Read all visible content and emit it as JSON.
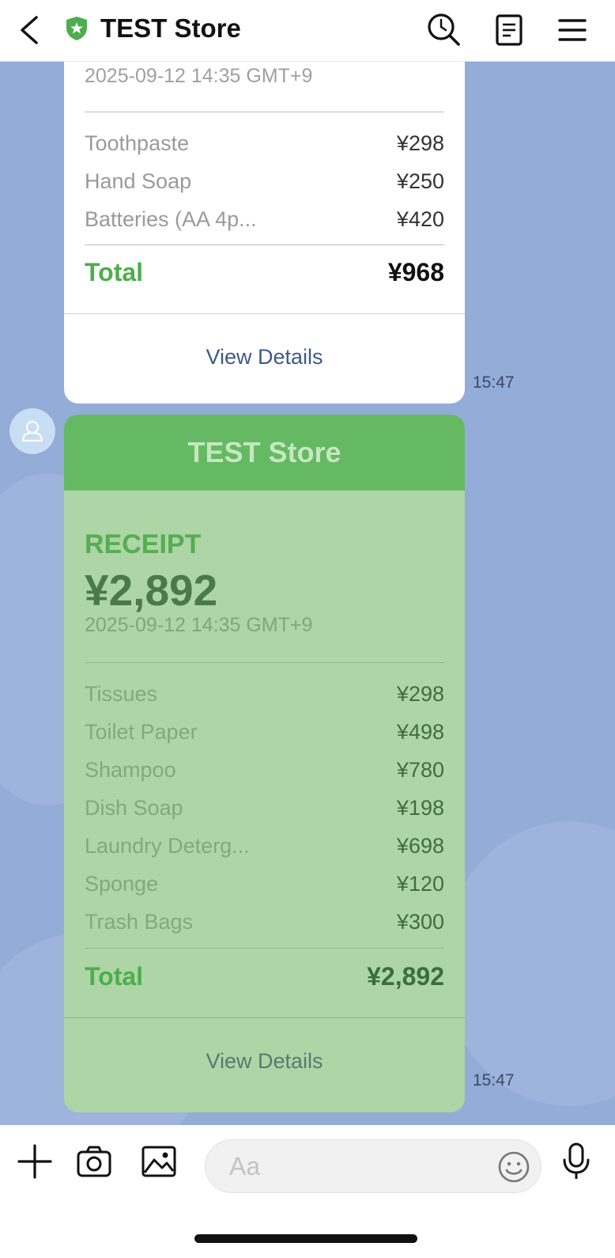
{
  "header": {
    "title": "TEST Store",
    "brand_color": "#4cae4c",
    "icons": [
      "back-icon",
      "shield-icon",
      "search-icon",
      "notes-icon",
      "menu-icon"
    ]
  },
  "messages": [
    {
      "date": "2025-09-12 14:35 GMT+9",
      "items": [
        {
          "name": "Toothpaste",
          "price": "¥298"
        },
        {
          "name": "Hand Soap",
          "price": "¥250"
        },
        {
          "name": "Batteries (AA 4p...",
          "price": "¥420"
        }
      ],
      "total_label": "Total",
      "total_value": "¥968",
      "details_label": "View Details",
      "time": "15:47"
    },
    {
      "store_name": "TEST Store",
      "receipt_label": "RECEIPT",
      "amount": "¥2,892",
      "date": "2025-09-12 14:35 GMT+9",
      "items": [
        {
          "name": "Tissues",
          "price": "¥298"
        },
        {
          "name": "Toilet Paper",
          "price": "¥498"
        },
        {
          "name": "Shampoo",
          "price": "¥780"
        },
        {
          "name": "Dish Soap",
          "price": "¥198"
        },
        {
          "name": "Laundry Deterg...",
          "price": "¥698"
        },
        {
          "name": "Sponge",
          "price": "¥120"
        },
        {
          "name": "Trash Bags",
          "price": "¥300"
        }
      ],
      "total_label": "Total",
      "total_value": "¥2,892",
      "details_label": "View Details",
      "time": "15:47"
    }
  ],
  "input": {
    "placeholder": "Aa",
    "value": ""
  },
  "colors": {
    "chat_background": "#93acd8",
    "receipt_banner": "#65b963",
    "receipt_card": "#aed5a6"
  }
}
